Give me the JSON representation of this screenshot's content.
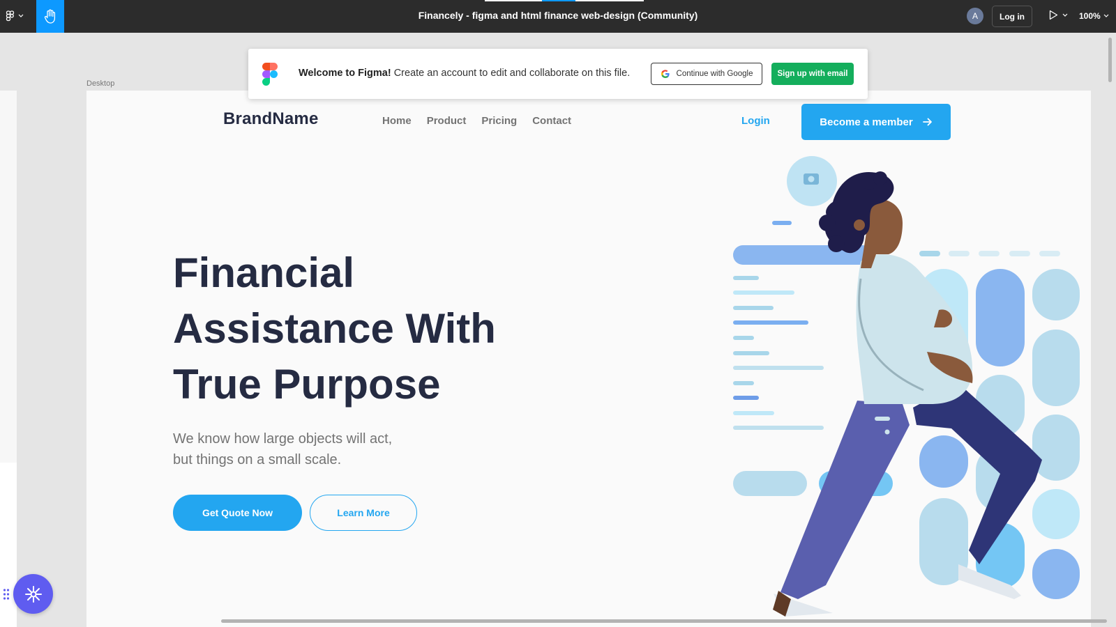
{
  "toolbar": {
    "title": "Financely - figma and html finance web-design (Community)",
    "avatar_initial": "A",
    "login_label": "Log in",
    "zoom": "100%"
  },
  "canvas": {
    "frame_label": "Desktop"
  },
  "banner": {
    "welcome_bold": "Welcome to Figma!",
    "welcome_text": "Create an account to edit and collaborate on this file.",
    "google_button": "Continue with Google",
    "email_button": "Sign up with email"
  },
  "page": {
    "brand": "BrandName",
    "nav": [
      "Home",
      "Product",
      "Pricing",
      "Contact"
    ],
    "login": "Login",
    "member_button": "Become a member",
    "hero_title_lines": [
      "Financial",
      "Assistance With",
      "True Purpose"
    ],
    "hero_sub_lines": [
      "We know how large objects will act,",
      "but things on a small scale."
    ],
    "quote_button": "Get Quote Now",
    "learn_button": "Learn More"
  },
  "colors": {
    "accent": "#23a6f0",
    "heading": "#252b42",
    "muted": "#737373",
    "figma_green": "#14ae5c",
    "figma_blue": "#0d99ff"
  }
}
